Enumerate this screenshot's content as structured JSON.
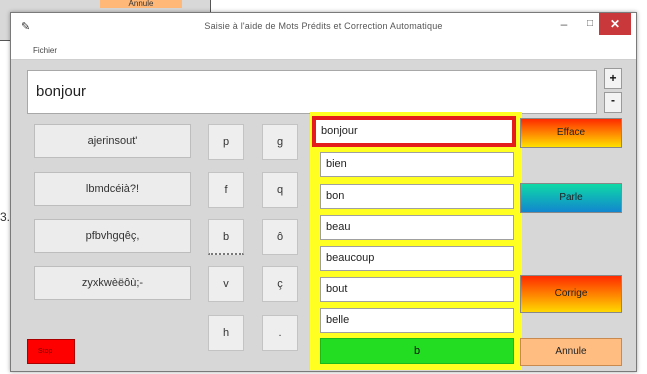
{
  "background": {
    "annule_label": "Annule",
    "stray_char": "3."
  },
  "window": {
    "title": "Saisie à l'aide de Mots Prédits et Correction Automatique",
    "menu": [
      "Fichier"
    ],
    "close_glyph": "✕",
    "min_glyph": "–",
    "max_glyph": "□",
    "app_icon": "pin-icon"
  },
  "textbox": {
    "value": "bonjour"
  },
  "spin": {
    "up": "+",
    "down": "-"
  },
  "groups": [
    "ajerinsout'",
    "lbmdcéià?!",
    "pfbvhgqêç,",
    "zyxkwèëôù;-"
  ],
  "keys": [
    [
      "p",
      "g"
    ],
    [
      "f",
      "q"
    ],
    [
      "b",
      "ô"
    ],
    [
      "v",
      "ç"
    ],
    [
      "h",
      "."
    ]
  ],
  "suggestions": [
    "bonjour",
    "bien",
    "bon",
    "beau",
    "beaucoup",
    "bout",
    "belle"
  ],
  "current_letter": "b",
  "actions": {
    "efface": "Efface",
    "parle": "Parle",
    "corrige": "Corrige",
    "annule": "Annule"
  },
  "stop_label": "Stop",
  "colors": {
    "suggestion_panel": "#ffff22",
    "selected_border": "#e51c1c",
    "current_letter_bg": "#22dd22",
    "close_button": "#c9383a",
    "stop_button": "#ff0000",
    "annule_button": "#ffbd82"
  }
}
